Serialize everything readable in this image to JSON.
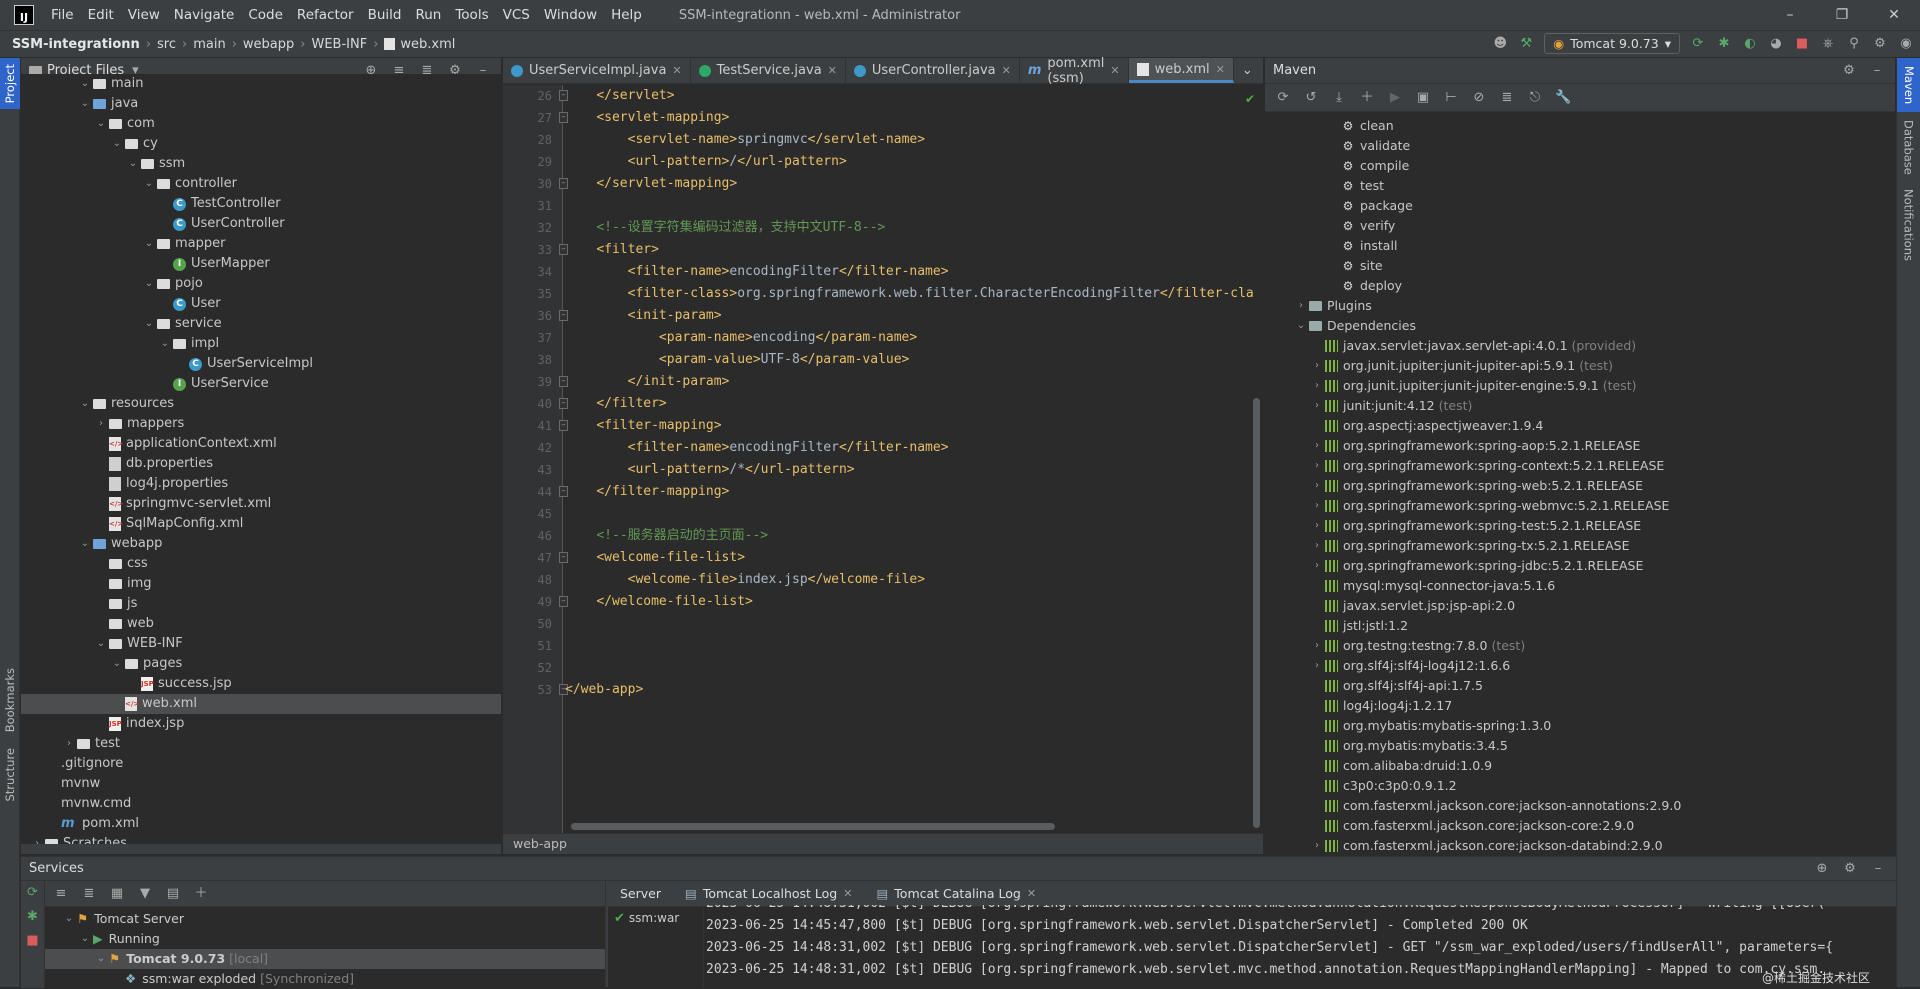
{
  "window": {
    "title": "SSM-integrationn - web.xml - Administrator",
    "menu": [
      "File",
      "Edit",
      "View",
      "Navigate",
      "Code",
      "Refactor",
      "Build",
      "Run",
      "Tools",
      "VCS",
      "Window",
      "Help"
    ]
  },
  "breadcrumb": [
    "SSM-integrationn",
    "src",
    "main",
    "webapp",
    "WEB-INF",
    "web.xml"
  ],
  "run_config": "Tomcat 9.0.73",
  "left_stripe": {
    "project": "Project",
    "bookmarks": "Bookmarks",
    "structure": "Structure"
  },
  "right_stripe": {
    "maven": "Maven",
    "database": "Database",
    "notifications": "Notifications"
  },
  "project_panel": {
    "title": "Project Files",
    "tree": [
      {
        "label": "main",
        "depth": 3,
        "icon": "folder",
        "arrow": "down"
      },
      {
        "label": "java",
        "depth": 3,
        "icon": "folder-blue",
        "arrow": "down"
      },
      {
        "label": "com",
        "depth": 4,
        "icon": "folder",
        "arrow": "down"
      },
      {
        "label": "cy",
        "depth": 5,
        "icon": "folder",
        "arrow": "down"
      },
      {
        "label": "ssm",
        "depth": 6,
        "icon": "folder",
        "arrow": "down"
      },
      {
        "label": "controller",
        "depth": 7,
        "icon": "folder",
        "arrow": "down"
      },
      {
        "label": "TestController",
        "depth": 8,
        "icon": "class"
      },
      {
        "label": "UserController",
        "depth": 8,
        "icon": "class"
      },
      {
        "label": "mapper",
        "depth": 7,
        "icon": "folder",
        "arrow": "down"
      },
      {
        "label": "UserMapper",
        "depth": 8,
        "icon": "interface"
      },
      {
        "label": "pojo",
        "depth": 7,
        "icon": "folder",
        "arrow": "down"
      },
      {
        "label": "User",
        "depth": 8,
        "icon": "class"
      },
      {
        "label": "service",
        "depth": 7,
        "icon": "folder",
        "arrow": "down"
      },
      {
        "label": "impl",
        "depth": 8,
        "icon": "folder",
        "arrow": "down"
      },
      {
        "label": "UserServiceImpl",
        "depth": 9,
        "icon": "class"
      },
      {
        "label": "UserService",
        "depth": 8,
        "icon": "interface"
      },
      {
        "label": "resources",
        "depth": 3,
        "icon": "folder",
        "arrow": "down"
      },
      {
        "label": "mappers",
        "depth": 4,
        "icon": "folder",
        "arrow": "right"
      },
      {
        "label": "applicationContext.xml",
        "depth": 4,
        "icon": "xml"
      },
      {
        "label": "db.properties",
        "depth": 4,
        "icon": "props"
      },
      {
        "label": "log4j.properties",
        "depth": 4,
        "icon": "props"
      },
      {
        "label": "springmvc-servlet.xml",
        "depth": 4,
        "icon": "xml"
      },
      {
        "label": "SqlMapConfig.xml",
        "depth": 4,
        "icon": "xml"
      },
      {
        "label": "webapp",
        "depth": 3,
        "icon": "folder-blue",
        "arrow": "down"
      },
      {
        "label": "css",
        "depth": 4,
        "icon": "folder"
      },
      {
        "label": "img",
        "depth": 4,
        "icon": "folder"
      },
      {
        "label": "js",
        "depth": 4,
        "icon": "folder"
      },
      {
        "label": "web",
        "depth": 4,
        "icon": "folder"
      },
      {
        "label": "WEB-INF",
        "depth": 4,
        "icon": "folder",
        "arrow": "down"
      },
      {
        "label": "pages",
        "depth": 5,
        "icon": "folder",
        "arrow": "down"
      },
      {
        "label": "success.jsp",
        "depth": 6,
        "icon": "jsp"
      },
      {
        "label": "web.xml",
        "depth": 5,
        "icon": "xml",
        "selected": true
      },
      {
        "label": "index.jsp",
        "depth": 4,
        "icon": "jsp"
      },
      {
        "label": "test",
        "depth": 2,
        "icon": "folder",
        "arrow": "right"
      },
      {
        "label": ".gitignore",
        "depth": 1,
        "icon": "text"
      },
      {
        "label": "mvnw",
        "depth": 1,
        "icon": "text"
      },
      {
        "label": "mvnw.cmd",
        "depth": 1,
        "icon": "text"
      },
      {
        "label": "pom.xml",
        "depth": 1,
        "icon": "maven"
      },
      {
        "label": "Scratches",
        "depth": 0,
        "icon": "folder",
        "arrow": "right"
      }
    ]
  },
  "editor": {
    "tabs": [
      {
        "label": "UserServiceImpl.java",
        "icon": "class"
      },
      {
        "label": "TestService.java",
        "icon": "class-green"
      },
      {
        "label": "UserController.java",
        "icon": "class"
      },
      {
        "label": "pom.xml (ssm)",
        "icon": "maven"
      },
      {
        "label": "web.xml",
        "icon": "xml",
        "active": true
      }
    ],
    "lines": [
      {
        "n": 26,
        "fold": true,
        "html": "    <span class='tg'>&lt;/servlet&gt;</span>"
      },
      {
        "n": 27,
        "fold": true,
        "html": "    <span class='tg'>&lt;servlet-mapping&gt;</span>"
      },
      {
        "n": 28,
        "html": "        <span class='tg'>&lt;servlet-name&gt;</span>springmvc<span class='tg'>&lt;/servlet-name&gt;</span>"
      },
      {
        "n": 29,
        "html": "        <span class='tg'>&lt;url-pattern&gt;</span>/<span class='tg'>&lt;/url-pattern&gt;</span>"
      },
      {
        "n": 30,
        "fold": true,
        "html": "    <span class='tg'>&lt;/servlet-mapping&gt;</span>"
      },
      {
        "n": 31,
        "html": ""
      },
      {
        "n": 32,
        "html": "    <span class='cm'>&lt;!--设置字符集编码过滤器，支持中文UTF-8--&gt;</span>"
      },
      {
        "n": 33,
        "fold": true,
        "html": "    <span class='tg'>&lt;filter&gt;</span>"
      },
      {
        "n": 34,
        "html": "        <span class='tg'>&lt;filter-name&gt;</span>encodingFilter<span class='tg'>&lt;/filter-name&gt;</span>"
      },
      {
        "n": 35,
        "html": "        <span class='tg'>&lt;filter-class&gt;</span>org.springframework.web.filter.CharacterEncodingFilter<span class='tg'>&lt;/filter-class&gt;</span>"
      },
      {
        "n": 36,
        "fold": true,
        "html": "        <span class='tg'>&lt;init-param&gt;</span>"
      },
      {
        "n": 37,
        "html": "            <span class='tg'>&lt;param-name&gt;</span>encoding<span class='tg'>&lt;/param-name&gt;</span>"
      },
      {
        "n": 38,
        "html": "            <span class='tg'>&lt;param-value&gt;</span>UTF-8<span class='tg'>&lt;/param-value&gt;</span>"
      },
      {
        "n": 39,
        "fold": true,
        "html": "        <span class='tg'>&lt;/init-param&gt;</span>"
      },
      {
        "n": 40,
        "fold": true,
        "html": "    <span class='tg'>&lt;/filter&gt;</span>"
      },
      {
        "n": 41,
        "fold": true,
        "html": "    <span class='tg'>&lt;filter-mapping&gt;</span>"
      },
      {
        "n": 42,
        "html": "        <span class='tg'>&lt;filter-name&gt;</span>encodingFilter<span class='tg'>&lt;/filter-name&gt;</span>"
      },
      {
        "n": 43,
        "html": "        <span class='tg'>&lt;url-pattern&gt;</span>/*<span class='tg'>&lt;/url-pattern&gt;</span>"
      },
      {
        "n": 44,
        "fold": true,
        "html": "    <span class='tg'>&lt;/filter-mapping&gt;</span>"
      },
      {
        "n": 45,
        "html": ""
      },
      {
        "n": 46,
        "html": "    <span class='cm'>&lt;!--服务器启动的主页面--&gt;</span>"
      },
      {
        "n": 47,
        "fold": true,
        "html": "    <span class='tg'>&lt;welcome-file-list&gt;</span>"
      },
      {
        "n": 48,
        "html": "        <span class='tg'>&lt;welcome-file&gt;</span>index.jsp<span class='tg'>&lt;/welcome-file&gt;</span>"
      },
      {
        "n": 49,
        "fold": true,
        "html": "    <span class='tg'>&lt;/welcome-file-list&gt;</span>"
      },
      {
        "n": 50,
        "html": ""
      },
      {
        "n": 51,
        "html": ""
      },
      {
        "n": 52,
        "html": ""
      },
      {
        "n": 53,
        "fold": true,
        "html": "<span class='tg'>&lt;/web-app&gt;</span>"
      }
    ],
    "status": "web-app"
  },
  "maven": {
    "title": "Maven",
    "items": [
      {
        "label": "clean",
        "kind": "goal",
        "depth": 3
      },
      {
        "label": "validate",
        "kind": "goal",
        "depth": 3
      },
      {
        "label": "compile",
        "kind": "goal",
        "depth": 3
      },
      {
        "label": "test",
        "kind": "goal",
        "depth": 3
      },
      {
        "label": "package",
        "kind": "goal",
        "depth": 3
      },
      {
        "label": "verify",
        "kind": "goal",
        "depth": 3
      },
      {
        "label": "install",
        "kind": "goal",
        "depth": 3
      },
      {
        "label": "site",
        "kind": "goal",
        "depth": 3
      },
      {
        "label": "deploy",
        "kind": "goal",
        "depth": 3
      },
      {
        "label": "Plugins",
        "kind": "folder",
        "depth": 1,
        "arrow": "right"
      },
      {
        "label": "Dependencies",
        "kind": "folder",
        "depth": 1,
        "arrow": "down"
      },
      {
        "label": "javax.servlet:javax.servlet-api:4.0.1",
        "scope": "(provided)",
        "kind": "dep",
        "depth": 2
      },
      {
        "label": "org.junit.jupiter:junit-jupiter-api:5.9.1",
        "scope": "(test)",
        "kind": "dep",
        "depth": 2,
        "arrow": "right"
      },
      {
        "label": "org.junit.jupiter:junit-jupiter-engine:5.9.1",
        "scope": "(test)",
        "kind": "dep",
        "depth": 2,
        "arrow": "right"
      },
      {
        "label": "junit:junit:4.12",
        "scope": "(test)",
        "kind": "dep",
        "depth": 2,
        "arrow": "right"
      },
      {
        "label": "org.aspectj:aspectjweaver:1.9.4",
        "kind": "dep",
        "depth": 2
      },
      {
        "label": "org.springframework:spring-aop:5.2.1.RELEASE",
        "kind": "dep",
        "depth": 2,
        "arrow": "right"
      },
      {
        "label": "org.springframework:spring-context:5.2.1.RELEASE",
        "kind": "dep",
        "depth": 2,
        "arrow": "right"
      },
      {
        "label": "org.springframework:spring-web:5.2.1.RELEASE",
        "kind": "dep",
        "depth": 2,
        "arrow": "right"
      },
      {
        "label": "org.springframework:spring-webmvc:5.2.1.RELEASE",
        "kind": "dep",
        "depth": 2,
        "arrow": "right"
      },
      {
        "label": "org.springframework:spring-test:5.2.1.RELEASE",
        "kind": "dep",
        "depth": 2,
        "arrow": "right"
      },
      {
        "label": "org.springframework:spring-tx:5.2.1.RELEASE",
        "kind": "dep",
        "depth": 2,
        "arrow": "right"
      },
      {
        "label": "org.springframework:spring-jdbc:5.2.1.RELEASE",
        "kind": "dep",
        "depth": 2,
        "arrow": "right"
      },
      {
        "label": "mysql:mysql-connector-java:5.1.6",
        "kind": "dep",
        "depth": 2
      },
      {
        "label": "javax.servlet.jsp:jsp-api:2.0",
        "kind": "dep",
        "depth": 2
      },
      {
        "label": "jstl:jstl:1.2",
        "kind": "dep",
        "depth": 2
      },
      {
        "label": "org.testng:testng:7.8.0",
        "scope": "(test)",
        "kind": "dep",
        "depth": 2,
        "arrow": "right"
      },
      {
        "label": "org.slf4j:slf4j-log4j12:1.6.6",
        "kind": "dep",
        "depth": 2,
        "arrow": "right"
      },
      {
        "label": "org.slf4j:slf4j-api:1.7.5",
        "kind": "dep",
        "depth": 2
      },
      {
        "label": "log4j:log4j:1.2.17",
        "kind": "dep",
        "depth": 2
      },
      {
        "label": "org.mybatis:mybatis-spring:1.3.0",
        "kind": "dep",
        "depth": 2
      },
      {
        "label": "org.mybatis:mybatis:3.4.5",
        "kind": "dep",
        "depth": 2
      },
      {
        "label": "com.alibaba:druid:1.0.9",
        "kind": "dep",
        "depth": 2
      },
      {
        "label": "c3p0:c3p0:0.9.1.2",
        "kind": "dep",
        "depth": 2
      },
      {
        "label": "com.fasterxml.jackson.core:jackson-annotations:2.9.0",
        "kind": "dep",
        "depth": 2
      },
      {
        "label": "com.fasterxml.jackson.core:jackson-core:2.9.0",
        "kind": "dep",
        "depth": 2
      },
      {
        "label": "com.fasterxml.jackson.core:jackson-databind:2.9.0",
        "kind": "dep",
        "depth": 2,
        "arrow": "right"
      }
    ]
  },
  "services": {
    "title": "Services",
    "tree": [
      {
        "label": "Tomcat Server",
        "depth": 1,
        "arrow": "down"
      },
      {
        "label": "Running",
        "depth": 2,
        "arrow": "down",
        "icon": "run"
      },
      {
        "label": "Tomcat 9.0.73",
        "extra": "[local]",
        "depth": 3,
        "arrow": "down",
        "selected": true
      },
      {
        "label": "ssm:war exploded",
        "extra": "[Synchronized]",
        "depth": 4
      }
    ],
    "tabs": [
      "Server",
      "Tomcat Localhost Log",
      "Tomcat Catalina Log"
    ],
    "deploy_item": "ssm:war",
    "log": [
      "2023-06-25 14:48:31,002 [$t] DEBUG [org.springframework.web.servlet.mvc.method.annotation.RequestResponseBodyMethodProcessor] - Writing [[User(",
      "2023-06-25 14:45:47,800 [$t] DEBUG [org.springframework.web.servlet.DispatcherServlet] - Completed 200 OK",
      "2023-06-25 14:48:31,002 [$t] DEBUG [org.springframework.web.servlet.DispatcherServlet] - GET \"/ssm_war_exploded/users/findUserAll\", parameters={",
      "2023-06-25 14:48:31,002 [$t] DEBUG [org.springframework.web.servlet.mvc.method.annotation.RequestMappingHandlerMapping] - Mapped to com.cy.ssm."
    ],
    "watermark": "@稀土掘金技术社区"
  }
}
